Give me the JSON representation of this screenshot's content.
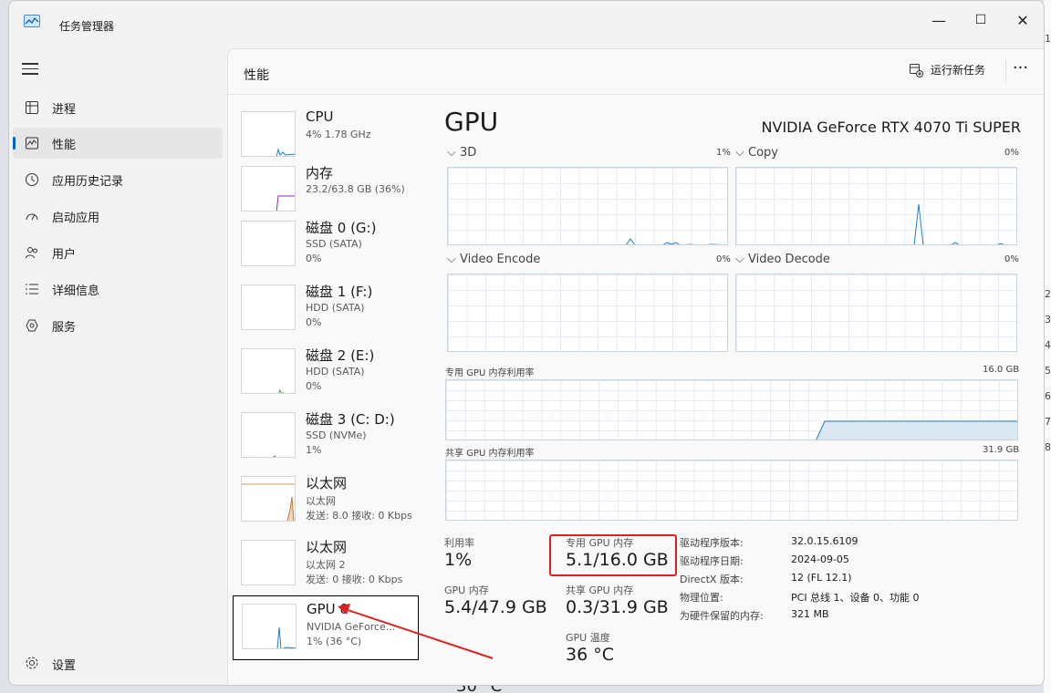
{
  "window": {
    "title": "任务管理器",
    "min": "—",
    "max": "☐",
    "close": "✕"
  },
  "nav": {
    "items": [
      {
        "label": "进程",
        "icon": "processes-icon"
      },
      {
        "label": "性能",
        "icon": "performance-icon",
        "active": true
      },
      {
        "label": "应用历史记录",
        "icon": "app-history-icon"
      },
      {
        "label": "启动应用",
        "icon": "startup-apps-icon"
      },
      {
        "label": "用户",
        "icon": "users-icon"
      },
      {
        "label": "详细信息",
        "icon": "details-icon"
      },
      {
        "label": "服务",
        "icon": "services-icon"
      }
    ],
    "settings": "设置"
  },
  "header": {
    "title": "性能",
    "run_task": "运行新任务",
    "more": "···"
  },
  "devices": [
    {
      "name": "CPU",
      "sub1": "4% 1.78 GHz",
      "sub2": "",
      "sub3": ""
    },
    {
      "name": "内存",
      "sub1": "23.2/63.8 GB (36%)",
      "sub2": "",
      "sub3": ""
    },
    {
      "name": "磁盘 0 (G:)",
      "sub1": "SSD (SATA)",
      "sub2": "0%",
      "sub3": ""
    },
    {
      "name": "磁盘 1 (F:)",
      "sub1": "HDD (SATA)",
      "sub2": "0%",
      "sub3": ""
    },
    {
      "name": "磁盘 2 (E:)",
      "sub1": "HDD (SATA)",
      "sub2": "0%",
      "sub3": ""
    },
    {
      "name": "磁盘 3 (C: D:)",
      "sub1": "SSD (NVMe)",
      "sub2": "1%",
      "sub3": ""
    },
    {
      "name": "以太网",
      "sub1": "以太网",
      "sub2": "发送: 8.0 接收: 0 Kbps",
      "sub3": ""
    },
    {
      "name": "以太网",
      "sub1": "以太网 2",
      "sub2": "发送: 0 接收: 0 Kbps",
      "sub3": ""
    },
    {
      "name": "GPU 0",
      "sub1": "NVIDIA GeForce...",
      "sub2": "1% (36 °C)",
      "sub3": ""
    }
  ],
  "gpu": {
    "title": "GPU",
    "model": "NVIDIA GeForce RTX 4070 Ti SUPER",
    "engines": [
      {
        "label": "3D",
        "pct": "1%"
      },
      {
        "label": "Copy",
        "pct": "0%"
      },
      {
        "label": "Video Encode",
        "pct": "0%"
      },
      {
        "label": "Video Decode",
        "pct": "0%"
      }
    ],
    "dedicated_label": "专用 GPU 内存利用率",
    "dedicated_max": "16.0 GB",
    "shared_label": "共享 GPU 内存利用率",
    "shared_max": "31.9 GB",
    "stats": {
      "util_label": "利用率",
      "util": "1%",
      "ded_label": "专用 GPU 内存",
      "ded": "5.1/16.0 GB",
      "gpumem_label": "GPU 内存",
      "gpumem": "5.4/47.9 GB",
      "shared_label": "共享 GPU 内存",
      "shared": "0.3/31.9 GB",
      "temp_label": "GPU 温度",
      "temp": "36 °C"
    },
    "info": [
      {
        "k": "驱动程序版本:",
        "v": "32.0.15.6109"
      },
      {
        "k": "驱动程序日期:",
        "v": "2024-09-05"
      },
      {
        "k": "DirectX 版本:",
        "v": "12 (FL 12.1)"
      },
      {
        "k": "物理位置:",
        "v": "PCI 总线 1、设备 0、功能 0"
      },
      {
        "k": "为硬件保留的内存:",
        "v": "321 MB"
      }
    ]
  },
  "background": {
    "right_digits": [
      "1",
      "2",
      "3",
      "4",
      "5",
      "6",
      "7",
      "8"
    ],
    "bottom_text": "30 °C"
  },
  "colors": {
    "accent": "#0067c0",
    "gpu_line": "#1c7ecb",
    "mem_line": "#8b2fa6",
    "disk_line": "#4aa34a",
    "net_line": "#c9742a",
    "highlight": "#e02020"
  }
}
